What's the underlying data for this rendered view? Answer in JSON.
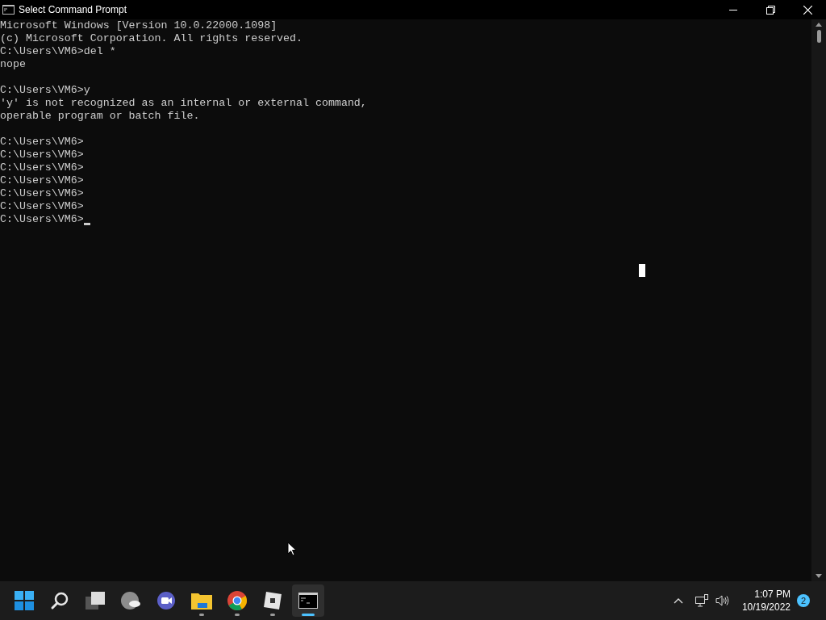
{
  "window": {
    "title": "Select Command Prompt"
  },
  "console": {
    "lines": [
      {
        "kind": "text",
        "text": "Microsoft Windows [Version 10.0.22000.1098]",
        "cursor": false
      },
      {
        "kind": "text",
        "text": "(c) Microsoft Corporation. All rights reserved.",
        "cursor": false
      },
      {
        "kind": "text",
        "text": "C:\\Users\\VM6>del *",
        "cursor": false
      },
      {
        "kind": "text",
        "text": "nope",
        "cursor": false
      },
      {
        "kind": "blank"
      },
      {
        "kind": "text",
        "text": "C:\\Users\\VM6>y",
        "cursor": false
      },
      {
        "kind": "text",
        "text": "'y' is not recognized as an internal or external command,",
        "cursor": false
      },
      {
        "kind": "text",
        "text": "operable program or batch file.",
        "cursor": false
      },
      {
        "kind": "blank"
      },
      {
        "kind": "text",
        "text": "C:\\Users\\VM6>",
        "cursor": false
      },
      {
        "kind": "text",
        "text": "C:\\Users\\VM6>",
        "cursor": false
      },
      {
        "kind": "text",
        "text": "C:\\Users\\VM6>",
        "cursor": false
      },
      {
        "kind": "text",
        "text": "C:\\Users\\VM6>",
        "cursor": false
      },
      {
        "kind": "text",
        "text": "C:\\Users\\VM6>",
        "cursor": false
      },
      {
        "kind": "text",
        "text": "C:\\Users\\VM6>",
        "cursor": false
      },
      {
        "kind": "text",
        "text": "C:\\Users\\VM6>",
        "cursor": true
      }
    ]
  },
  "taskbar": {
    "apps": [
      {
        "kind": "start",
        "running": false,
        "selected": false
      },
      {
        "kind": "search",
        "running": false,
        "selected": false
      },
      {
        "kind": "taskview",
        "running": false,
        "selected": false
      },
      {
        "kind": "weather",
        "running": false,
        "selected": false
      },
      {
        "kind": "meet",
        "running": false,
        "selected": false
      },
      {
        "kind": "folder",
        "running": true,
        "selected": false
      },
      {
        "kind": "browser",
        "running": true,
        "selected": false
      },
      {
        "kind": "cube",
        "running": true,
        "selected": false
      },
      {
        "kind": "terminal",
        "running": true,
        "selected": true
      }
    ],
    "time": "1:07 PM",
    "date": "10/19/2022",
    "notifications": "2"
  }
}
